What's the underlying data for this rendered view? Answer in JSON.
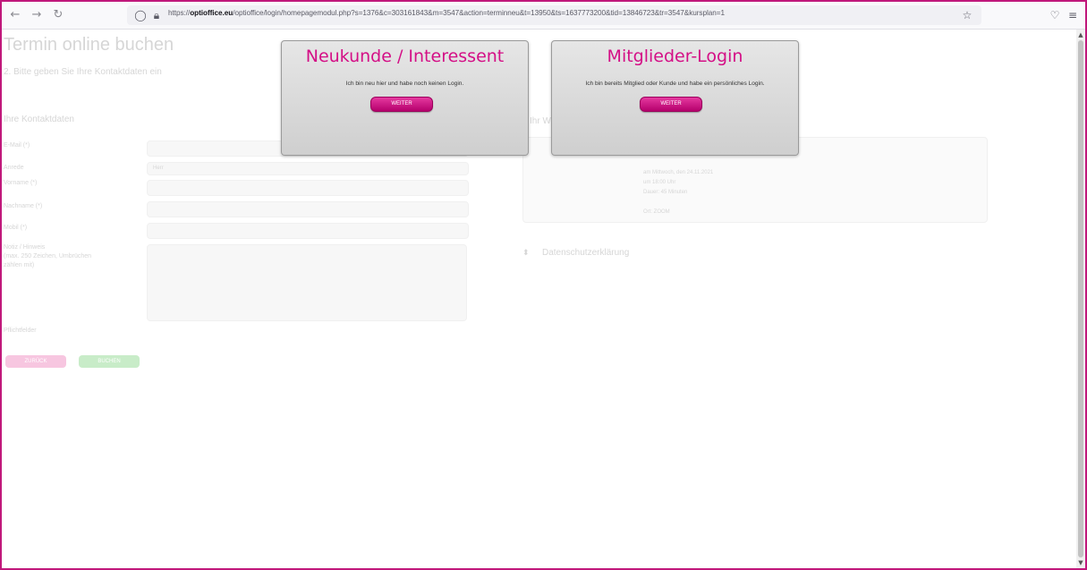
{
  "browser": {
    "url_prefix": "https://",
    "url_domain": "optioffice.eu",
    "url_rest": "/optioffice/login/homepagemodul.php?s=1376&c=303161843&m=3547&action=terminneu&t=13950&ts=1637773200&tid=13846723&tr=3547&kursplan=1"
  },
  "page": {
    "title": "Termin online buchen",
    "subtitle": "2. Bitte geben Sie Ihre Kontaktdaten ein",
    "contact_heading": "Ihre Kontaktdaten",
    "labels": {
      "email": "E-Mail (*)",
      "anrede": "Anrede",
      "vorname": "Vorname (*)",
      "nachname": "Nachname (*)",
      "mobil": "Mobil (*)",
      "notiz": "Notiz / Hinweis",
      "notiz_hint1": "(max. 250 Zeichen, Umbrüchen",
      "notiz_hint2": "zählen mit)",
      "pflichtfelder": "Pflichtfelder"
    },
    "anrede_value": "Herr",
    "buttons": {
      "back": "ZURÜCK",
      "book": "BUCHEN"
    },
    "booking_heading": "Ihr Wunschtermin",
    "booking_details": {
      "date": "am Mittwoch, den 24.11.2021",
      "time": "um 18:00 Uhr",
      "duration": "Dauer: 45 Minuten",
      "location": "Ort: ZOOM"
    },
    "privacy_label": "Datenschutzerklärung"
  },
  "overlay": {
    "new_customer": {
      "title": "Neukunde / Interessent",
      "text": "Ich bin neu hier und habe noch keinen Login.",
      "button": "WEITER"
    },
    "member_login": {
      "title": "Mitglieder-Login",
      "text": "Ich bin bereits Mitglied oder Kunde und habe ein persönliches Login.",
      "button": "WEITER"
    }
  },
  "colors": {
    "accent": "#d40f86",
    "frame": "#c0187b"
  }
}
